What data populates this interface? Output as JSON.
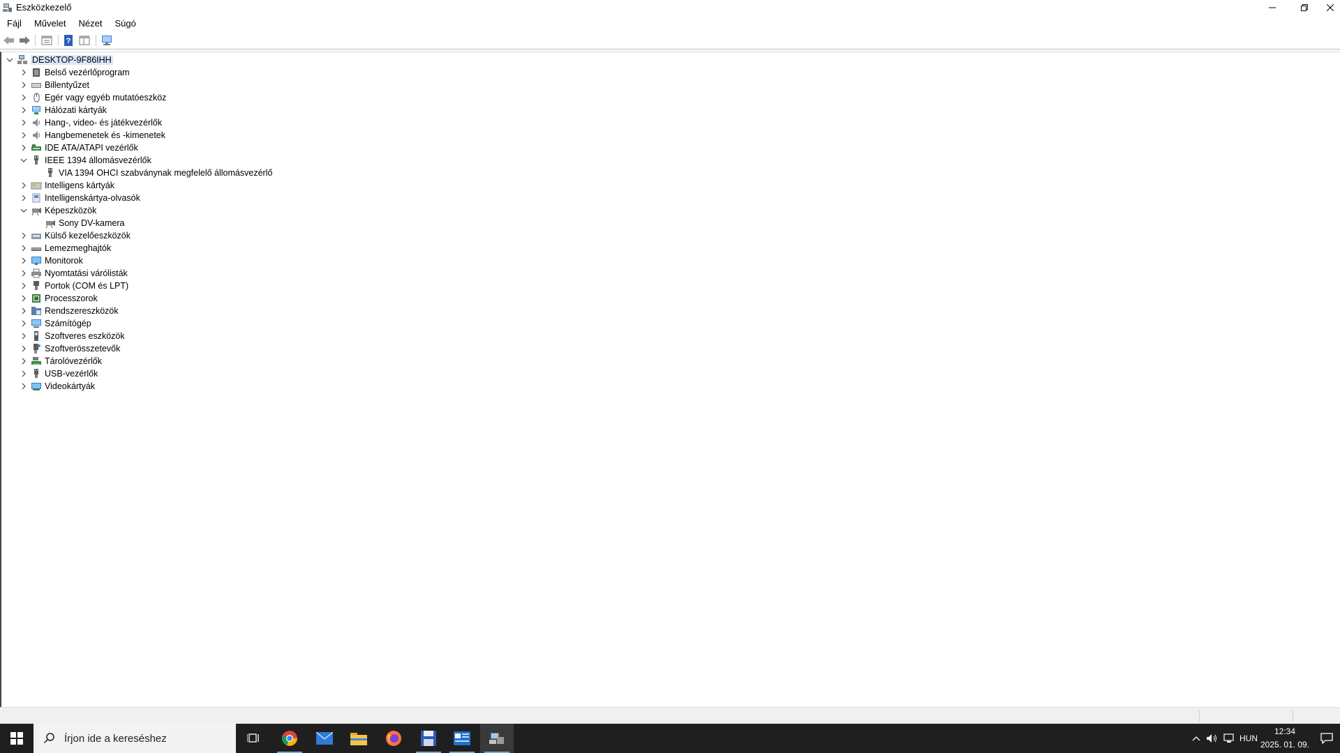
{
  "window": {
    "title": "Eszközkezelő",
    "icon": "device-manager-icon"
  },
  "menu": [
    {
      "label": "Fájl"
    },
    {
      "label": "Művelet"
    },
    {
      "label": "Nézet"
    },
    {
      "label": "Súgó"
    }
  ],
  "toolbar": {
    "buttons": [
      "back-arrow-icon",
      "forward-arrow-icon",
      "properties-icon",
      "help-icon",
      "view-icon",
      "monitor-scan-icon"
    ]
  },
  "tree": {
    "root": {
      "label": "DESKTOP-9F86IHH",
      "expanded": true,
      "icon": "computer-tree-icon"
    },
    "categories": [
      {
        "label": "Belső vezérlőprogram",
        "expanded": false,
        "icon": "firmware-icon"
      },
      {
        "label": "Billentyűzet",
        "expanded": false,
        "icon": "keyboard-icon"
      },
      {
        "label": "Egér vagy egyéb mutatóeszköz",
        "expanded": false,
        "icon": "mouse-icon"
      },
      {
        "label": "Hálózati kártyák",
        "expanded": false,
        "icon": "network-icon"
      },
      {
        "label": "Hang-, video- és játékvezérlők",
        "expanded": false,
        "icon": "speaker-icon"
      },
      {
        "label": "Hangbemenetek és -kimenetek",
        "expanded": false,
        "icon": "speaker-icon"
      },
      {
        "label": "IDE ATA/ATAPI vezérlők",
        "expanded": false,
        "icon": "ide-controller-icon"
      },
      {
        "label": "IEEE 1394 állomásvezérlők",
        "expanded": true,
        "icon": "plug-icon",
        "children": [
          {
            "label": "VIA 1394 OHCI szabványnak megfelelő állomásvezérlő",
            "icon": "plug-icon"
          }
        ]
      },
      {
        "label": "Intelligens kártyák",
        "expanded": false,
        "icon": "smartcard-icon"
      },
      {
        "label": "Intelligenskártya-olvasók",
        "expanded": false,
        "icon": "card-reader-icon"
      },
      {
        "label": "Képeszközök",
        "expanded": true,
        "icon": "camera-icon",
        "children": [
          {
            "label": "Sony DV-kamera",
            "icon": "camera-icon"
          }
        ]
      },
      {
        "label": "Külső kezelőeszközök",
        "expanded": false,
        "icon": "hid-icon"
      },
      {
        "label": "Lemezmeghajtók",
        "expanded": false,
        "icon": "disk-icon"
      },
      {
        "label": "Monitorok",
        "expanded": false,
        "icon": "monitor-icon"
      },
      {
        "label": "Nyomtatási várólisták",
        "expanded": false,
        "icon": "printer-icon"
      },
      {
        "label": "Portok (COM és LPT)",
        "expanded": false,
        "icon": "port-icon"
      },
      {
        "label": "Processzorok",
        "expanded": false,
        "icon": "processor-icon"
      },
      {
        "label": "Rendszereszközök",
        "expanded": false,
        "icon": "system-folder-icon"
      },
      {
        "label": "Számítógép",
        "expanded": false,
        "icon": "computer-icon"
      },
      {
        "label": "Szoftveres eszközök",
        "expanded": false,
        "icon": "software-device-icon"
      },
      {
        "label": "Szoftverösszetevők",
        "expanded": false,
        "icon": "software-component-icon"
      },
      {
        "label": "Tárolóvezérlők",
        "expanded": false,
        "icon": "storage-controller-icon"
      },
      {
        "label": "USB-vezérlők",
        "expanded": false,
        "icon": "usb-icon"
      },
      {
        "label": "Videokártyák",
        "expanded": false,
        "icon": "display-adapter-icon"
      }
    ]
  },
  "taskbar": {
    "search_placeholder": "Írjon ide a kereséshez",
    "apps": [
      {
        "name": "task-view-icon",
        "active": false
      },
      {
        "name": "chrome-icon",
        "active": false,
        "running": true
      },
      {
        "name": "mail-icon",
        "active": false
      },
      {
        "name": "file-explorer-icon",
        "active": false
      },
      {
        "name": "firefox-icon",
        "active": false
      },
      {
        "name": "save-disk-app-icon",
        "active": false,
        "running": true
      },
      {
        "name": "news-app-icon",
        "active": false,
        "running": true
      },
      {
        "name": "device-manager-icon",
        "active": true,
        "running": true
      }
    ],
    "tray": {
      "language": "HUN",
      "time": "12:34",
      "date": "2025. 01. 09.",
      "icons": [
        "chevron-up-icon",
        "volume-icon",
        "network-tray-icon",
        "notification-icon"
      ]
    }
  },
  "colors": {
    "taskbar_bg": "#1f1f1f",
    "selection_bg": "#d9e8fb",
    "accent": "#0078d4"
  }
}
